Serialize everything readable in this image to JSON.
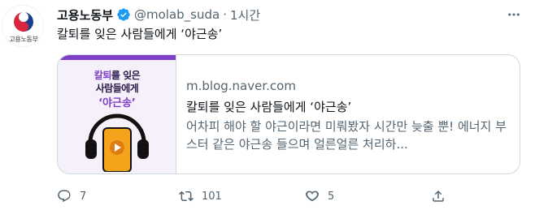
{
  "account": {
    "name": "고용노동부",
    "handle": "@molab_suda",
    "separator": "·",
    "time": "1시간",
    "avatar_label": "고용노동부"
  },
  "tweet": {
    "text": "칼퇴를 잊은 사람들에게 ‘야근송’"
  },
  "card": {
    "thumbnail": {
      "line1_highlight": "칼퇴",
      "line1_rest": "를 잊은",
      "line2": "사람들에게",
      "line3": "‘야근송’"
    },
    "domain": "m.blog.naver.com",
    "title": "칼퇴를 잊은 사람들에게 ‘야근송’",
    "description": "어차피 해야 할 야근이라면 미뤄봤자 시간만 늦출 뿐! 에너지 부스터 같은 야근송 들으며 얼른얼른 처리하..."
  },
  "actions": {
    "reply_count": "7",
    "retweet_count": "101",
    "like_count": "5"
  },
  "colors": {
    "verified": "#1d9bf0",
    "secondary_text": "#536471",
    "border": "#cfd9de",
    "thumb_accent": "#7e3fc6"
  },
  "icons": [
    "verified-badge-icon",
    "more-icon",
    "reply-icon",
    "retweet-icon",
    "like-icon",
    "share-icon",
    "headphones-icon",
    "phone-icon"
  ]
}
